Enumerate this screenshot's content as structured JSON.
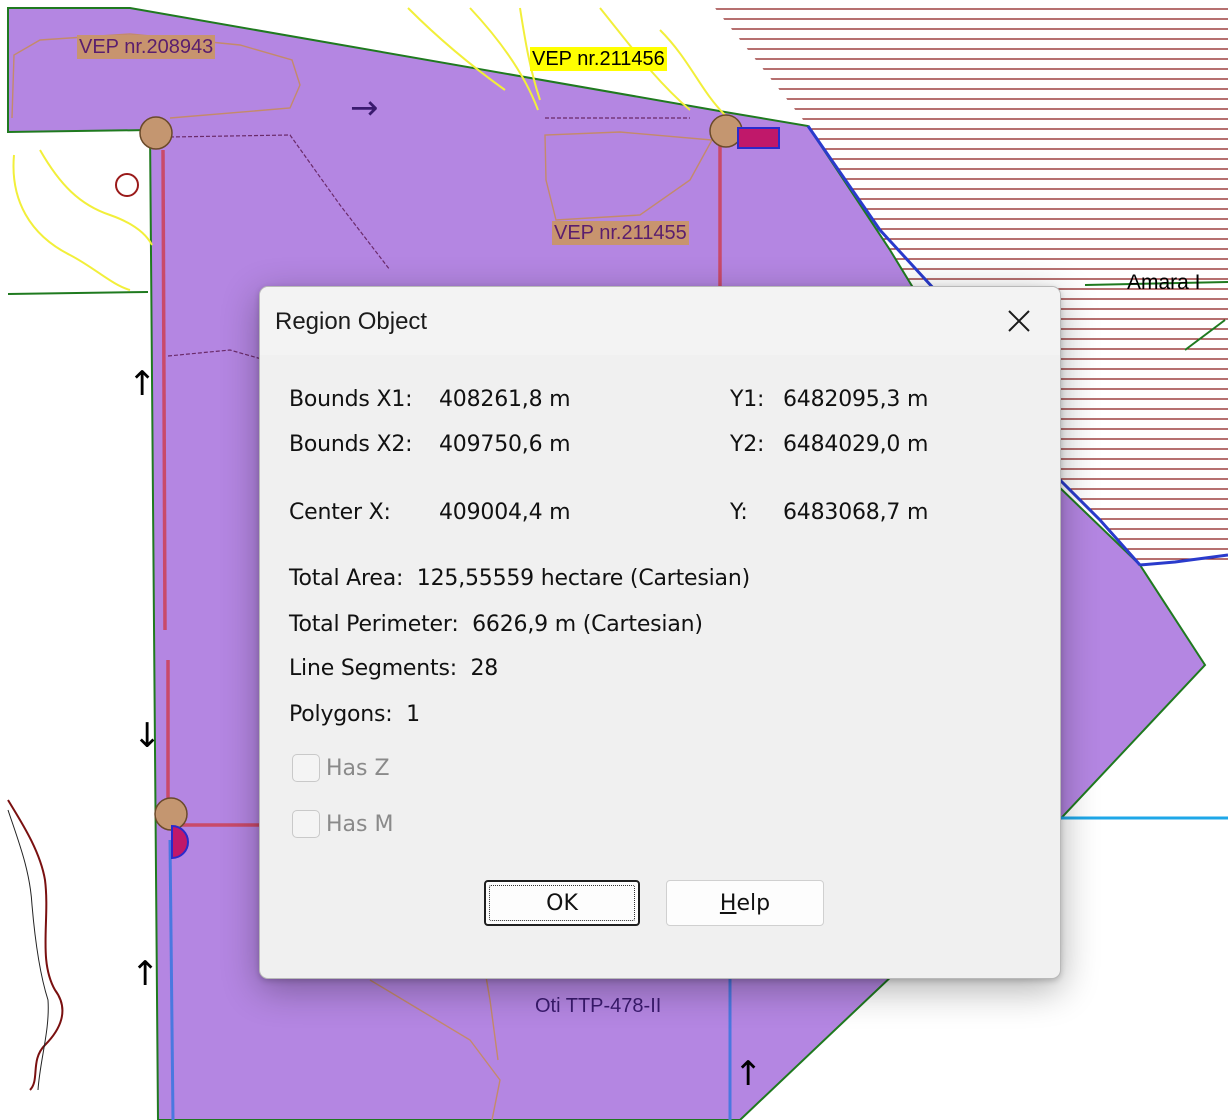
{
  "map": {
    "labels": {
      "vep_208943": "VEP nr.208943",
      "vep_211456": "VEP nr.211456",
      "vep_211455": "VEP nr.211455",
      "amara": "Amara I",
      "oti": "Oti TTP-478-II"
    },
    "arrows": {
      "right": "→",
      "up": "↑",
      "down": "↓"
    },
    "colors": {
      "region_fill": "#b486e2",
      "hatch": "#8b1a1a",
      "road_yellow": "#f2ef3a",
      "line_green": "#1f7a1f",
      "line_blue": "#3d5bd9",
      "line_cyan": "#1ea7e8",
      "pipe_red": "#c94a6a",
      "node": "#c49670"
    }
  },
  "dialog": {
    "title": "Region Object",
    "close_icon": "close-icon",
    "bounds": {
      "x1_label": "Bounds X1:",
      "x1_value": "408261,8 m",
      "y1_label": "Y1:",
      "y1_value": "6482095,3 m",
      "x2_label": "Bounds X2:",
      "x2_value": "409750,6 m",
      "y2_label": "Y2:",
      "y2_value": "6484029,0 m"
    },
    "center": {
      "x_label": "Center X:",
      "x_value": "409004,4 m",
      "y_label": "Y:",
      "y_value": "6483068,7 m"
    },
    "total_area": "Total Area:  125,55559 hectare (Cartesian)",
    "total_perimeter": "Total Perimeter:  6626,9 m (Cartesian)",
    "line_segments": "Line Segments:  28",
    "polygons": "Polygons:  1",
    "has_z": {
      "label": "Has Z",
      "checked": false,
      "enabled": false
    },
    "has_m": {
      "label": "Has M",
      "checked": false,
      "enabled": false
    },
    "ok_label": "OK",
    "help_mnemonic": "H",
    "help_rest": "elp"
  }
}
